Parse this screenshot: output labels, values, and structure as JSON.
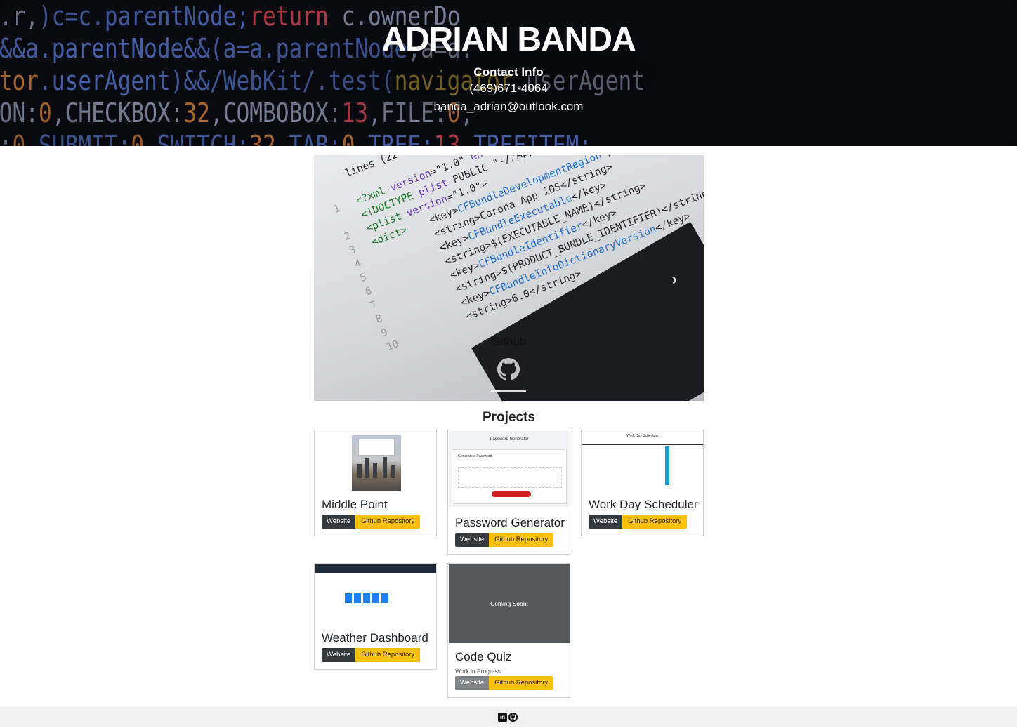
{
  "header": {
    "name": "ADRIAN BANDA",
    "contact_heading": "Contact Info",
    "phone": "(469)671-4064",
    "email": "banda_adrian@outlook.com"
  },
  "carousel": {
    "caption": "Github",
    "next_icon": "chevron-right-icon",
    "slide_icon": "github-icon"
  },
  "projects": {
    "title": "Projects",
    "cards": [
      {
        "title": "Middle Point",
        "website_label": "Website",
        "repo_label": "Github Repository"
      },
      {
        "title": "Password Generator",
        "website_label": "Website",
        "repo_label": "Github Repository",
        "thumb_title": "Password Generator",
        "thumb_subtitle": "Generate a Password"
      },
      {
        "title": "Work Day Scheduler",
        "website_label": "Website",
        "repo_label": "Github Repository",
        "thumb_title": "Work Day Scheduler"
      },
      {
        "title": "Weather Dashboard",
        "website_label": "Website",
        "repo_label": "Github Repository"
      },
      {
        "title": "Code Quiz",
        "note": "Work in Progress",
        "website_label": "Website",
        "repo_label": "Github Repository",
        "image_text": "Coming Soon!"
      }
    ]
  },
  "footer": {
    "icons": [
      "linkedin-icon",
      "github-icon"
    ],
    "linkedin_glyph": "in"
  },
  "colors": {
    "dark_button": "#343a40",
    "warning_button": "#ffc107",
    "footer_bg": "#f1f1f1"
  }
}
